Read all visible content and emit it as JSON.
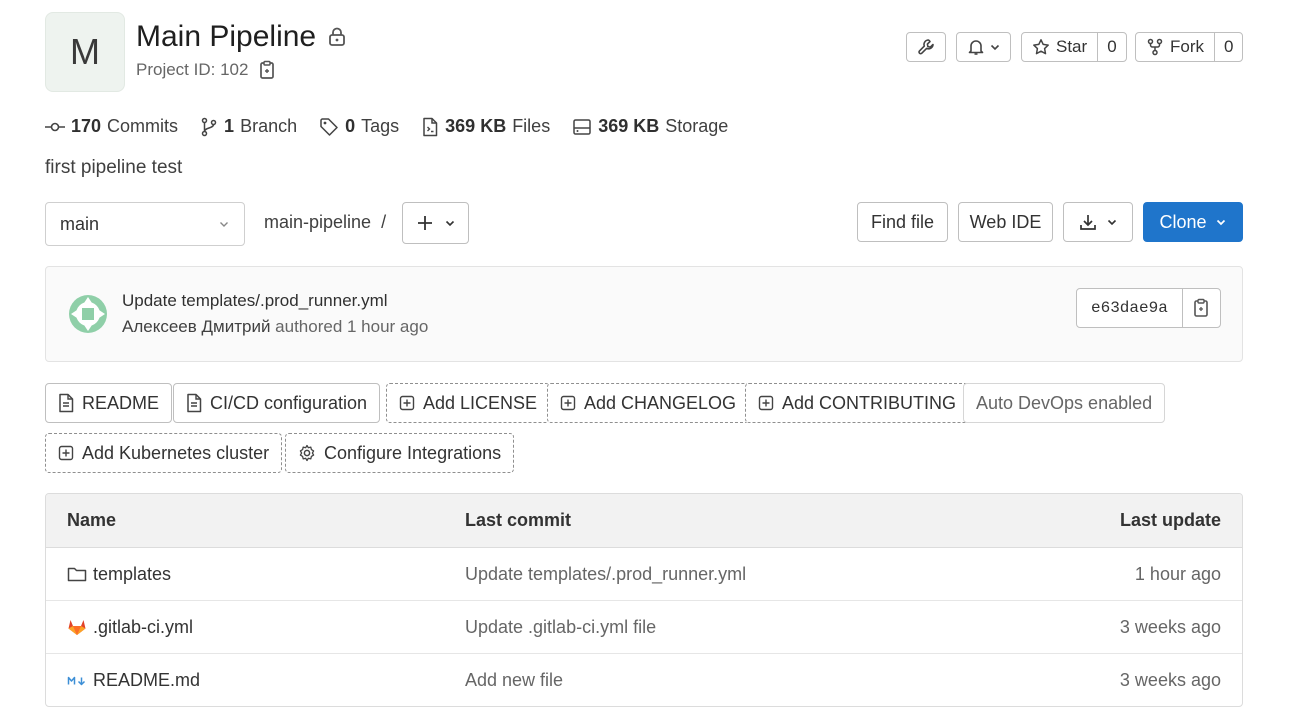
{
  "project": {
    "avatar_letter": "M",
    "title": "Main Pipeline",
    "project_id_label": "Project ID: 102"
  },
  "header_actions": {
    "star_label": "Star",
    "star_count": "0",
    "fork_label": "Fork",
    "fork_count": "0"
  },
  "stats": {
    "commits_count": "170",
    "commits_label": "Commits",
    "branch_count": "1",
    "branch_label": "Branch",
    "tags_count": "0",
    "tags_label": "Tags",
    "files_size": "369 KB",
    "files_label": "Files",
    "storage_size": "369 KB",
    "storage_label": "Storage"
  },
  "description": "first pipeline test",
  "toolbar": {
    "branch": "main",
    "path": "main-pipeline",
    "separator": "/",
    "find_file": "Find file",
    "web_ide": "Web IDE",
    "clone": "Clone"
  },
  "last_commit": {
    "title": "Update templates/.prod_runner.yml",
    "author": "Алексеев Дмитрий",
    "meta": "authored 1 hour ago",
    "sha": "e63dae9a"
  },
  "quick_links": [
    {
      "label": "README"
    },
    {
      "label": "CI/CD configuration"
    },
    {
      "label": "Add LICENSE"
    },
    {
      "label": "Add CHANGELOG"
    },
    {
      "label": "Add CONTRIBUTING"
    },
    {
      "label": "Auto DevOps enabled"
    },
    {
      "label": "Add Kubernetes cluster"
    },
    {
      "label": "Configure Integrations"
    }
  ],
  "file_table": {
    "headers": {
      "name": "Name",
      "last_commit": "Last commit",
      "last_update": "Last update"
    },
    "rows": [
      {
        "name": "templates",
        "icon": "folder-icon",
        "commit": "Update templates/.prod_runner.yml",
        "updated": "1 hour ago"
      },
      {
        "name": ".gitlab-ci.yml",
        "icon": "gitlab-icon",
        "commit": "Update .gitlab-ci.yml file",
        "updated": "3 weeks ago"
      },
      {
        "name": "README.md",
        "icon": "markdown-icon",
        "commit": "Add new file",
        "updated": "3 weeks ago"
      }
    ]
  },
  "colors": {
    "primary": "#1f75cb",
    "gitlab_orange": "#e24329",
    "commit_avatar": "#8fcfa8"
  }
}
